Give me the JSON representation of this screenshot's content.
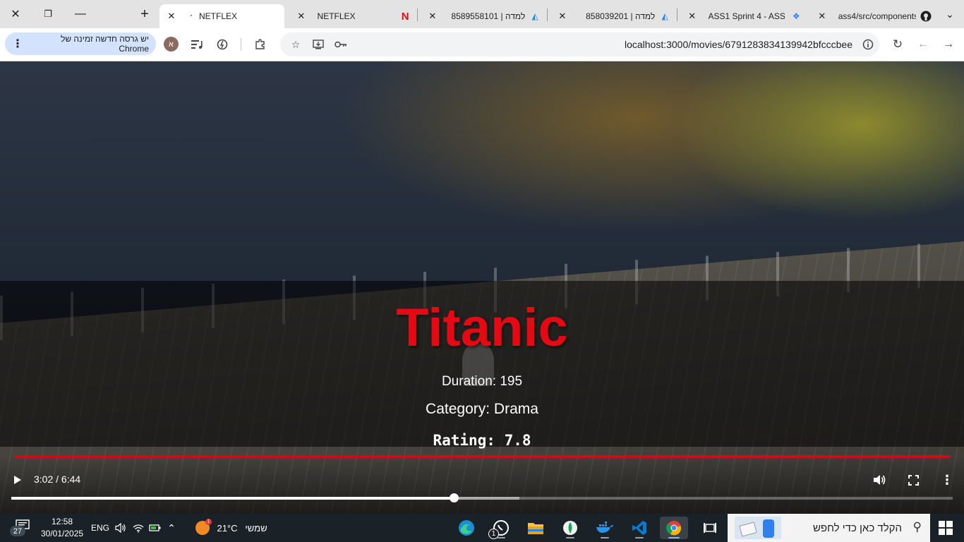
{
  "browser": {
    "tabs": [
      {
        "title": "NETFLEX",
        "favicon": "page-loading-icon",
        "active": true
      },
      {
        "title": "NETFLEX",
        "favicon": "netflix-n-icon",
        "active": false
      },
      {
        "title": "8589558101 | למדה",
        "favicon": "lamda-icon",
        "active": false
      },
      {
        "title": "858039201 | למדה",
        "favicon": "lamda-icon",
        "active": false
      },
      {
        "title": "ASS1 Sprint 4 - ASS1",
        "favicon": "jira-icon",
        "active": false
      },
      {
        "title": "ass4/src/components",
        "favicon": "github-icon",
        "active": false
      }
    ],
    "update_banner": "יש גרסה חדשה זמינה של Chrome",
    "profile_initial": "א",
    "url": "localhost:3000/movies/6791283834139942bfcccbee"
  },
  "movie": {
    "title": "Titanic",
    "duration": "Duration: 195",
    "category": "Category: Drama",
    "rating": "Rating: 7.8"
  },
  "player": {
    "time": "3:02 / 6:44",
    "played_fraction": 0.47,
    "buffered_fraction": 0.54
  },
  "taskbar": {
    "time": "12:58",
    "date": "30/01/2025",
    "language": "ENG",
    "temperature": "21°C",
    "weather_label": "שמשי",
    "search_placeholder": "הקלד כאן כדי לחפש",
    "notification_count": "27",
    "whatsapp_badge": "1",
    "weather_badge": "1"
  }
}
